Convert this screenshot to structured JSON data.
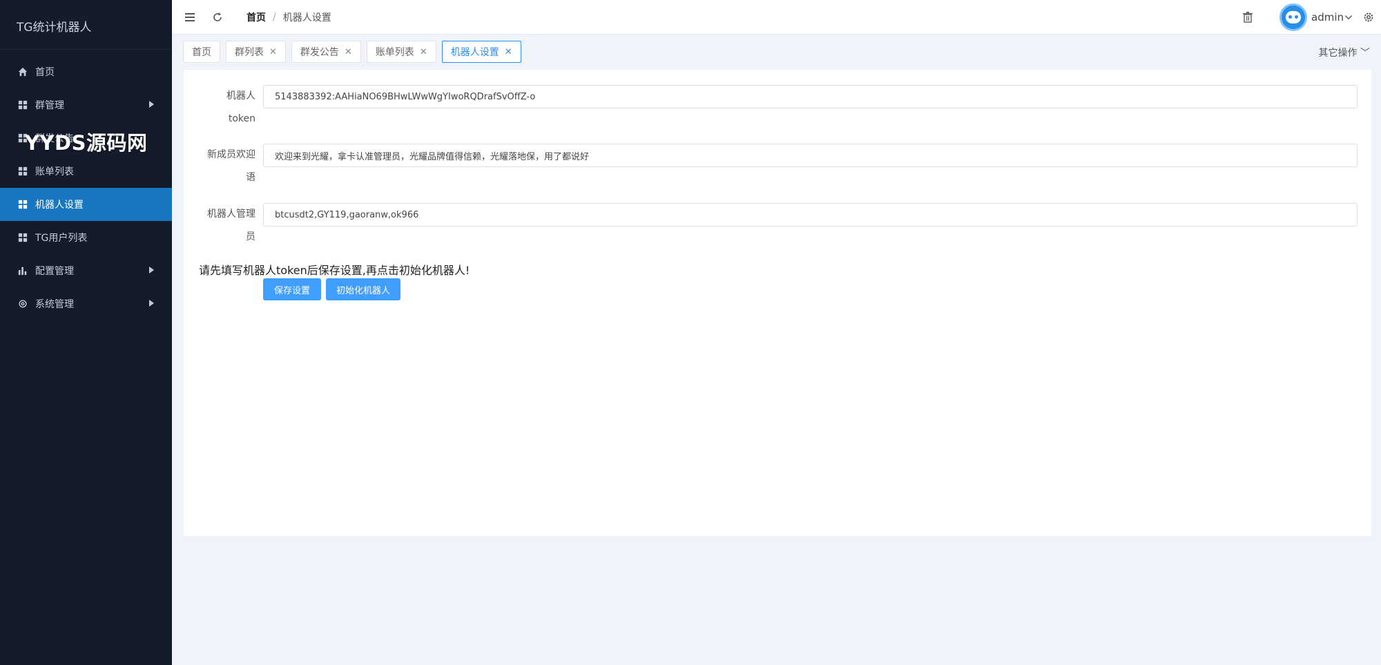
{
  "app": {
    "title": "TG统计机器人"
  },
  "watermark": "YYDS源码网",
  "sidebar": {
    "items": [
      {
        "label": "首页",
        "icon": "home-icon"
      },
      {
        "label": "群管理",
        "icon": "grid-icon",
        "has_children": true
      },
      {
        "label": "群发公告",
        "icon": "grid-icon"
      },
      {
        "label": "账单列表",
        "icon": "grid-icon"
      },
      {
        "label": "机器人设置",
        "icon": "grid-icon",
        "active": true
      },
      {
        "label": "TG用户列表",
        "icon": "grid-icon"
      },
      {
        "label": "配置管理",
        "icon": "bar-chart-icon",
        "has_children": true
      },
      {
        "label": "系统管理",
        "icon": "gear-icon",
        "has_children": true
      }
    ]
  },
  "header": {
    "breadcrumb": [
      "首页",
      "机器人设置"
    ],
    "separator": "/",
    "username": "admin"
  },
  "tabs": {
    "items": [
      "首页",
      "群列表",
      "群发公告",
      "账单列表",
      "机器人设置"
    ],
    "active": "机器人设置",
    "other_ops": "其它操作 ﹀"
  },
  "form": {
    "token": {
      "label_line1": "机器人",
      "label_line2": "token",
      "value": "5143883392:AAHiaNO69BHwLWwWgYIwoRQDrafSvOffZ-o"
    },
    "welcome": {
      "label_line1": "新成员欢迎",
      "label_line2": "语",
      "value": "欢迎来到光耀，拿卡认准管理员，光耀品牌值得信赖，光耀落地保，用了都说好"
    },
    "admins": {
      "label_line1": "机器人管理",
      "label_line2": "员",
      "value": "btcusdt2,GY119,gaoranw,ok966"
    },
    "notice": "请先填写机器人token后保存设置,再点击初始化机器人!",
    "save_label": "保存设置",
    "init_label": "初始化机器人"
  },
  "colors": {
    "sidebar_bg": "#141c2c",
    "active_nav": "#1976c0",
    "accent": "#409eff"
  }
}
